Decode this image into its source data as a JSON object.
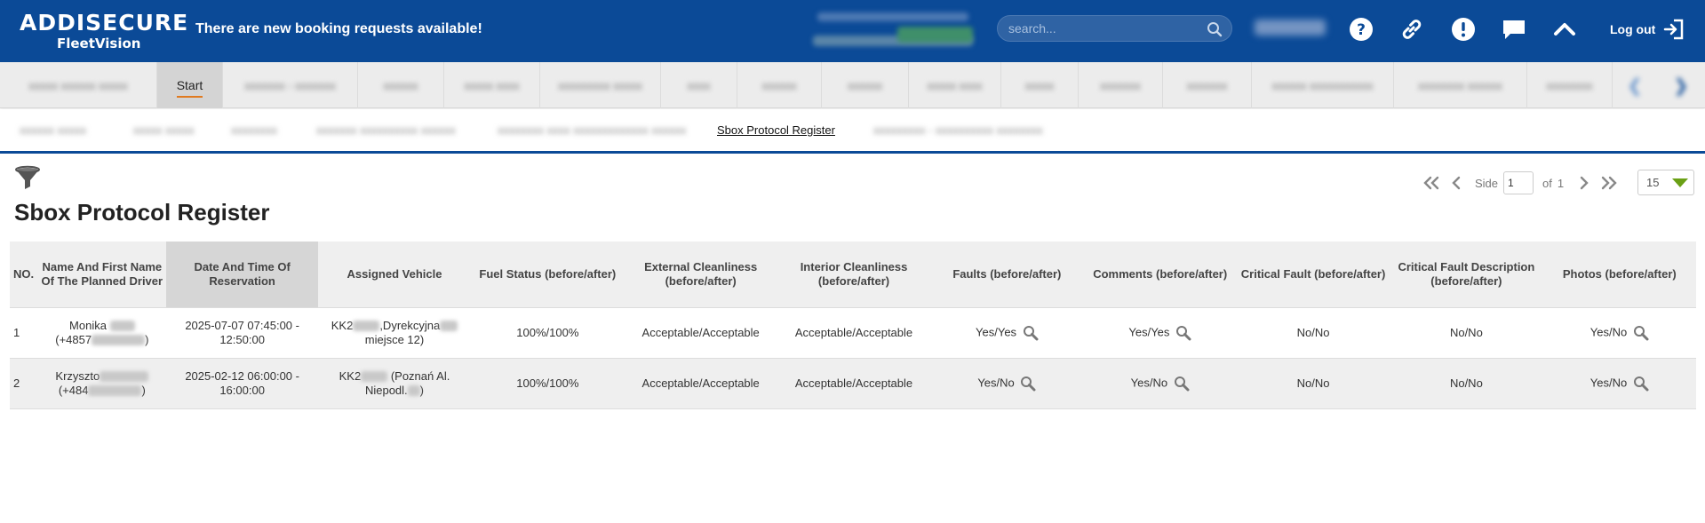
{
  "header": {
    "logo_top": "ADDISECURE",
    "logo_bottom": "FleetVision",
    "notice": "There are new booking requests available!",
    "search_placeholder": "search...",
    "logout_label": "Log out",
    "colors": {
      "bar": "#0b4a97",
      "accent": "#e07a1f"
    },
    "icons": [
      "help-icon",
      "link-icon",
      "alert-icon",
      "chat-icon",
      "collapse-up-icon",
      "logout-icon"
    ]
  },
  "main_nav": {
    "active_label": "Start"
  },
  "sub_nav": {
    "active_label": "Sbox Protocol Register"
  },
  "page": {
    "title": "Sbox Protocol Register"
  },
  "pager": {
    "side_label": "Side",
    "current_page": "1",
    "of_label": "of",
    "total_pages": "1",
    "page_size": "15"
  },
  "table": {
    "columns": [
      "NO.",
      "Name And First Name Of The Planned Driver",
      "Date And Time Of Reservation",
      "Assigned Vehicle",
      "Fuel Status (before/after)",
      "External Cleanliness (before/after)",
      "Interior Cleanliness (before/after)",
      "Faults (before/after)",
      "Comments (before/after)",
      "Critical Fault (before/after)",
      "Critical Fault Description (before/after)",
      "Photos (before/after)"
    ],
    "rows": [
      {
        "no": "1",
        "driver_a": "Monika",
        "driver_b": "(+4857",
        "driver_c": ")",
        "date_a": "2025-07-07 07:45:00 -",
        "date_b": "12:50:00",
        "vehicle_a": "KK2",
        "vehicle_b": ",Dyrekcyjna",
        "vehicle_c": "miejsce 12)",
        "fuel": "100%/100%",
        "ext": "Acceptable/Acceptable",
        "int": "Acceptable/Acceptable",
        "faults": "Yes/Yes",
        "comments": "Yes/Yes",
        "critical": "No/No",
        "critical_desc": "No/No",
        "photos": "Yes/No"
      },
      {
        "no": "2",
        "driver_a": "Krzyszto",
        "driver_b": "(+484",
        "driver_c": ")",
        "date_a": "2025-02-12 06:00:00 -",
        "date_b": "16:00:00",
        "vehicle_a": "KK2",
        "vehicle_b": " (Poznań Al.",
        "vehicle_c": "Niepodl.",
        "vehicle_d": ")",
        "fuel": "100%/100%",
        "ext": "Acceptable/Acceptable",
        "int": "Acceptable/Acceptable",
        "faults": "Yes/No",
        "comments": "Yes/No",
        "critical": "No/No",
        "critical_desc": "No/No",
        "photos": "Yes/No"
      }
    ]
  }
}
